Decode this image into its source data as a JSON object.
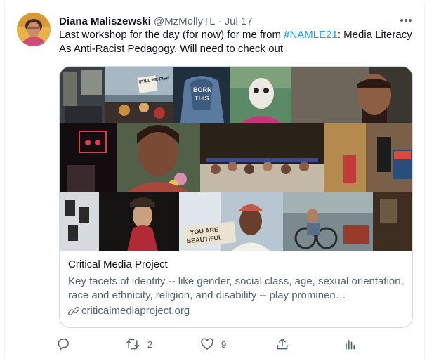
{
  "tweet": {
    "display_name": "Diana Maliszewski",
    "handle": "@MzMollyTL",
    "separator": "·",
    "time": "Jul 17",
    "text_before": "Last workshop for the day (for now) for me from ",
    "hashtag": "#NAMLE21",
    "text_after": ": Media Literacy As Anti-Racist Pedagogy. Will need to check out"
  },
  "card": {
    "title": "Critical Media Project",
    "description": "Key facets of identity -- like gender, social class, age, sexual orientation, race and ethnicity, religion, and disability -- play prominen…",
    "domain": "criticalmediaproject.org",
    "image_signs": {
      "protest": "STILL WE RISE",
      "jacket": "BORN THIS",
      "beautiful_top": "YOU ARE",
      "beautiful_bottom": "BEAUTIFUL"
    }
  },
  "actions": {
    "reply_count": "",
    "retweet_count": "2",
    "like_count": "9"
  },
  "icons": {
    "more": "more-horizontal-icon",
    "reply": "reply-icon",
    "retweet": "retweet-icon",
    "like": "heart-icon",
    "share": "share-icon",
    "analytics": "analytics-icon",
    "link": "link-icon"
  },
  "colors": {
    "text_primary": "#0f1419",
    "text_secondary": "#536471",
    "accent": "#1d9bf0",
    "border": "#cfd9de"
  }
}
